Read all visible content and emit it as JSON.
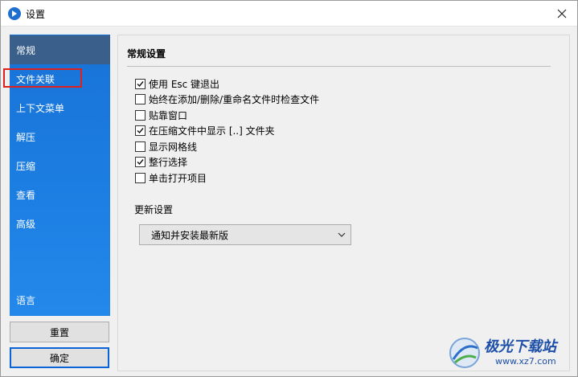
{
  "window": {
    "title": "设置"
  },
  "sidebar": {
    "items": [
      {
        "label": "常规"
      },
      {
        "label": "文件关联"
      },
      {
        "label": "上下文菜单"
      },
      {
        "label": "解压"
      },
      {
        "label": "压缩"
      },
      {
        "label": "查看"
      },
      {
        "label": "高级"
      },
      {
        "label": "语言"
      }
    ]
  },
  "buttons": {
    "reset": "重置",
    "ok": "确定"
  },
  "general": {
    "title": "常规设置",
    "options": [
      {
        "label": "使用 Esc 键退出",
        "checked": true
      },
      {
        "label": "始终在添加/删除/重命名文件时检查文件",
        "checked": false
      },
      {
        "label": "贴靠窗口",
        "checked": false
      },
      {
        "label": "在压缩文件中显示 [..] 文件夹",
        "checked": true
      },
      {
        "label": "显示网格线",
        "checked": false
      },
      {
        "label": "整行选择",
        "checked": true
      },
      {
        "label": "单击打开项目",
        "checked": false
      }
    ],
    "update_label": "更新设置",
    "update_value": "通知并安装最新版"
  },
  "watermark": {
    "text": "极光下载站",
    "url": "www.xz7.com"
  },
  "colors": {
    "sidebar": "#1d7fe3",
    "active_item": "#3a5f8a",
    "highlight": "#e0201c"
  }
}
